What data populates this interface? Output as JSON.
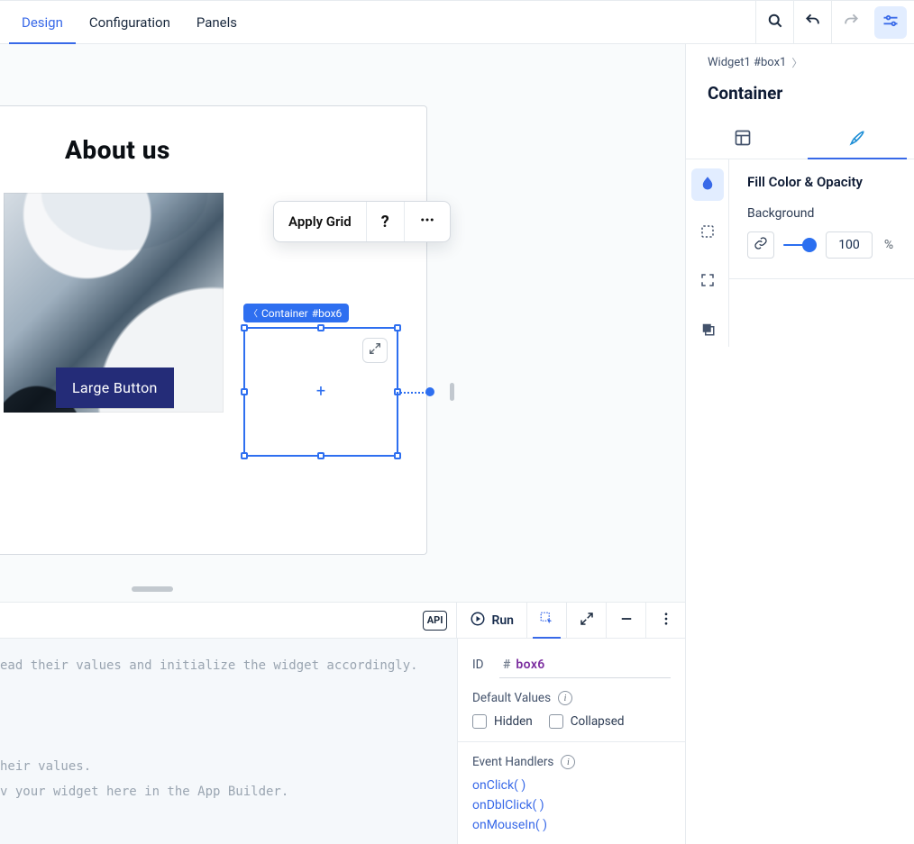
{
  "topbar": {
    "tabs": {
      "design": "Design",
      "configuration": "Configuration",
      "panels": "Panels"
    }
  },
  "canvas": {
    "page_title": "About us",
    "large_button": "Large Button",
    "float_toolbar": {
      "apply_grid": "Apply Grid",
      "help": "?",
      "more": "⋯"
    },
    "selection": {
      "badge_prefix": "Container",
      "badge_id": "#box6",
      "plus": "+"
    }
  },
  "inspector": {
    "breadcrumb": "Widget1 #box1",
    "title": "Container",
    "section_title": "Fill Color & Opacity",
    "background_label": "Background",
    "opacity_value": "100",
    "opacity_unit": "%"
  },
  "bottom": {
    "api": "API",
    "run": "Run",
    "code_line1": "ead their values and initialize the widget accordingly.",
    "code_line2": "heir values.",
    "code_line3": "v your widget here in the App Builder.",
    "props": {
      "id_label": "ID",
      "id_hash": "#",
      "id_value": "box6",
      "default_values": "Default Values",
      "hidden": "Hidden",
      "collapsed": "Collapsed",
      "event_handlers": "Event Handlers",
      "on_click": "onClick( )",
      "on_dbl_click": "onDblClick( )",
      "on_mouse_in": "onMouseIn( )"
    }
  }
}
